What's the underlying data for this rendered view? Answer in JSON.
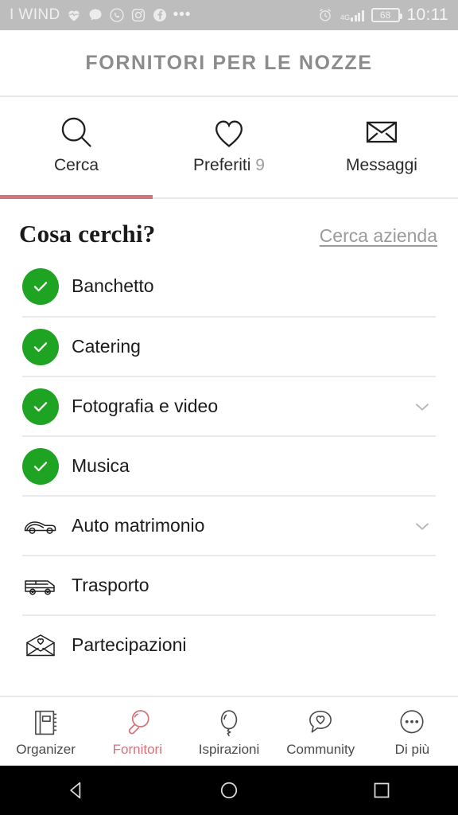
{
  "status_bar": {
    "carrier": "I WIND",
    "icons": [
      "health-heart-icon",
      "chat-bubble-icon",
      "whatsapp-icon",
      "instagram-icon",
      "facebook-icon",
      "overflow-dots-icon"
    ],
    "more_dots": "•••",
    "alarm_icon": "alarm-clock-icon",
    "network_type": "4G",
    "battery_level": "68",
    "time": "10:11",
    "background_color": "#bdbdbd"
  },
  "header": {
    "title": "FORNITORI PER LE NOZZE"
  },
  "tabs": {
    "active_index": 0,
    "accent_color": "#d4737c",
    "items": [
      {
        "label": "Cerca",
        "icon": "search-icon",
        "count": ""
      },
      {
        "label": "Preferiti",
        "icon": "heart-icon",
        "count": "9"
      },
      {
        "label": "Messaggi",
        "icon": "envelope-icon",
        "count": ""
      }
    ]
  },
  "main": {
    "section_title": "Cosa cerchi?",
    "section_link": "Cerca azienda",
    "check_color": "#1fa322",
    "categories": [
      {
        "label": "Banchetto",
        "checked": true,
        "icon": "check-circle-icon",
        "expandable": false
      },
      {
        "label": "Catering",
        "checked": true,
        "icon": "check-circle-icon",
        "expandable": false
      },
      {
        "label": "Fotografia e video",
        "checked": true,
        "icon": "check-circle-icon",
        "expandable": true
      },
      {
        "label": "Musica",
        "checked": true,
        "icon": "check-circle-icon",
        "expandable": false
      },
      {
        "label": "Auto matrimonio",
        "checked": false,
        "icon": "classic-car-icon",
        "expandable": true
      },
      {
        "label": "Trasporto",
        "checked": false,
        "icon": "bus-icon",
        "expandable": false
      },
      {
        "label": "Partecipazioni",
        "checked": false,
        "icon": "envelope-heart-icon",
        "expandable": false
      }
    ]
  },
  "bottom_nav": {
    "active_index": 1,
    "active_color": "#d4737c",
    "items": [
      {
        "label": "Organizer",
        "icon": "notebook-icon"
      },
      {
        "label": "Fornitori",
        "icon": "magnifier-icon"
      },
      {
        "label": "Ispirazioni",
        "icon": "balloon-icon"
      },
      {
        "label": "Community",
        "icon": "speech-heart-icon"
      },
      {
        "label": "Di più",
        "icon": "more-circle-icon"
      }
    ]
  },
  "android_nav": {
    "back": "back-triangle-icon",
    "home": "home-circle-icon",
    "recents": "recents-square-icon"
  }
}
